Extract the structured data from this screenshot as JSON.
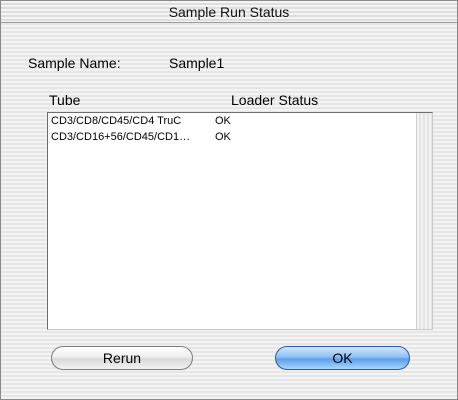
{
  "window": {
    "title": "Sample Run Status"
  },
  "sample": {
    "label": "Sample Name:",
    "value": "Sample1"
  },
  "table": {
    "columns": [
      "Tube",
      "Loader Status"
    ],
    "rows": [
      {
        "tube": "CD3/CD8/CD45/CD4 TruC",
        "status": "OK"
      },
      {
        "tube": "CD3/CD16+56/CD45/CD1…",
        "status": "OK"
      }
    ]
  },
  "buttons": {
    "rerun": "Rerun",
    "ok": "OK"
  },
  "colors": {
    "default_button": "#6aa8ec",
    "window_bg": "#ececec"
  }
}
